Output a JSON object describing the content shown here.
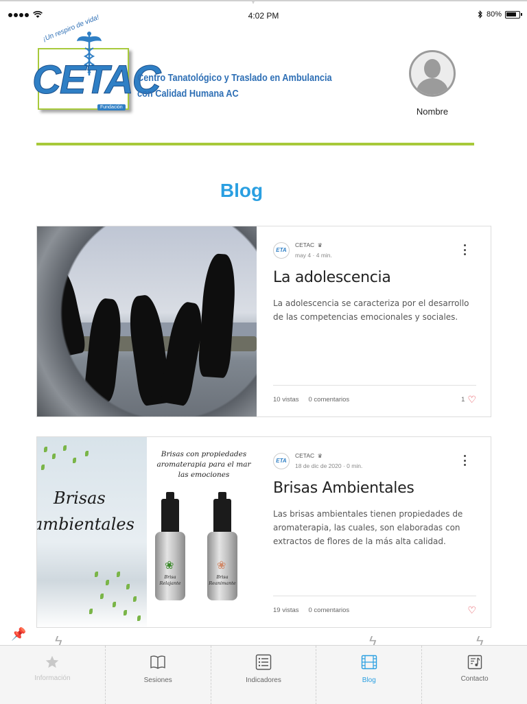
{
  "status_bar": {
    "time": "4:02 PM",
    "battery": "80%"
  },
  "header": {
    "logo_text": "CETAC",
    "logo_tagline": "¡Un respiro de vida!",
    "logo_foundation": "Fundación",
    "org_name_line1": "Centro Tanatológico y Traslado en Ambulancia",
    "org_name_line2": "con Calidad Humana AC",
    "user_name": "Nombre"
  },
  "page": {
    "title": "Blog"
  },
  "posts": [
    {
      "author": "CETAC",
      "author_avatar_text": "ETA",
      "date": "may 4",
      "read_time": "4 min.",
      "title": "La adolescencia",
      "excerpt": "La adolescencia se caracteriza por el desarrollo de las competencias emocionales y sociales.",
      "views": "10 vistas",
      "comments": "0 comentarios",
      "likes": "1"
    },
    {
      "author": "CETAC",
      "author_avatar_text": "ETA",
      "date": "18 de dic de 2020",
      "read_time": "0 min.",
      "title": "Brisas Ambientales",
      "excerpt": "Las brisas ambientales tienen propiedades de aromaterapia, las cuales, son elaboradas con extractos de flores de la más alta calidad.",
      "views": "19 vistas",
      "comments": "0 comentarios",
      "likes": "",
      "image_text": {
        "headline_line1": "Brisas",
        "headline_line2": "ambientales",
        "promo_line1": "Brisas con propiedades",
        "promo_line2": "aromaterapia para el mar",
        "promo_line3": "las emociones",
        "bottle1_line1": "Brisa",
        "bottle1_line2": "Relajante",
        "bottle2_line1": "Brisa",
        "bottle2_line2": "Reanimante"
      }
    }
  ],
  "tab_bar": {
    "tabs": [
      {
        "label": "Información",
        "icon": "star-icon",
        "state": "disabled"
      },
      {
        "label": "Sesiones",
        "icon": "book-icon",
        "state": "normal"
      },
      {
        "label": "Indicadores",
        "icon": "list-icon",
        "state": "normal"
      },
      {
        "label": "Blog",
        "icon": "film-icon",
        "state": "active"
      },
      {
        "label": "Contacto",
        "icon": "music-note-icon",
        "state": "normal"
      }
    ]
  },
  "colors": {
    "accent_blue": "#2a9fe1",
    "brand_green": "#a7c93a",
    "brand_blue": "#2f7fc5",
    "heart_red": "#e0303c"
  }
}
